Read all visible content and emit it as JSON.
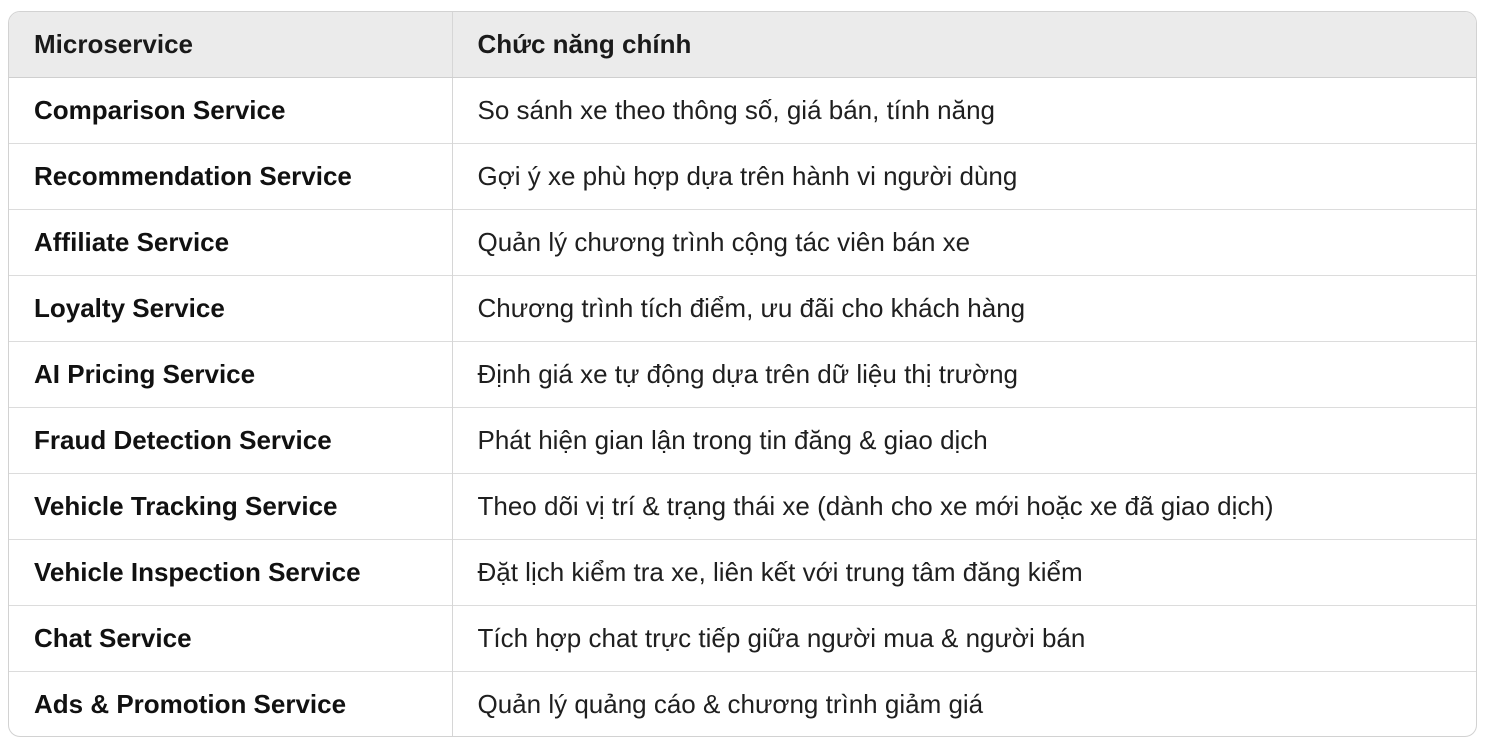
{
  "table": {
    "headers": [
      "Microservice",
      "Chức năng chính"
    ],
    "rows": [
      {
        "service": "Comparison Service",
        "function": "So sánh xe theo thông số, giá bán, tính năng"
      },
      {
        "service": "Recommendation Service",
        "function": "Gợi ý xe phù hợp dựa trên hành vi người dùng"
      },
      {
        "service": "Affiliate Service",
        "function": "Quản lý chương trình cộng tác viên bán xe"
      },
      {
        "service": "Loyalty Service",
        "function": "Chương trình tích điểm, ưu đãi cho khách hàng"
      },
      {
        "service": "AI Pricing Service",
        "function": "Định giá xe tự động dựa trên dữ liệu thị trường"
      },
      {
        "service": "Fraud Detection Service",
        "function": "Phát hiện gian lận trong tin đăng & giao dịch"
      },
      {
        "service": "Vehicle Tracking Service",
        "function": "Theo dõi vị trí & trạng thái xe (dành cho xe mới hoặc xe đã giao dịch)"
      },
      {
        "service": "Vehicle Inspection Service",
        "function": "Đặt lịch kiểm tra xe, liên kết với trung tâm đăng kiểm"
      },
      {
        "service": "Chat Service",
        "function": "Tích hợp chat trực tiếp giữa người mua & người bán"
      },
      {
        "service": "Ads & Promotion Service",
        "function": "Quản lý quảng cáo & chương trình giảm giá"
      }
    ]
  }
}
